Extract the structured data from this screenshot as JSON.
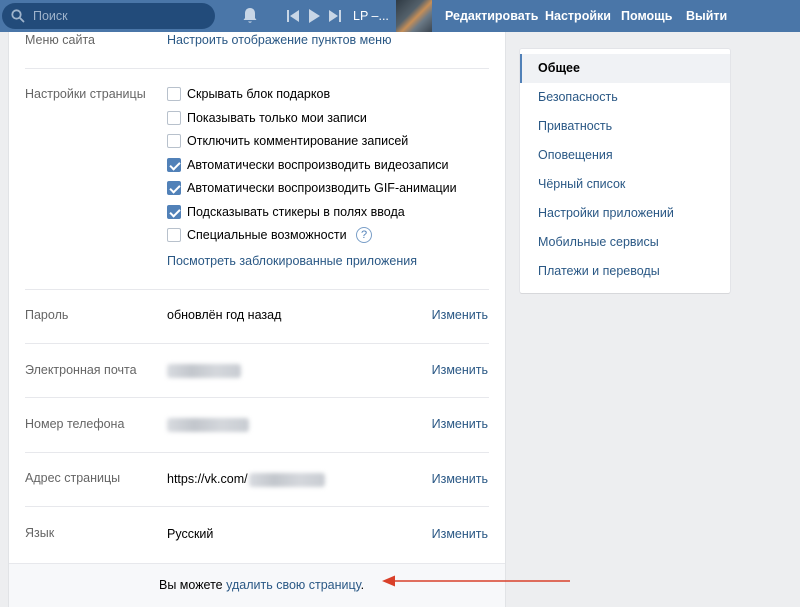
{
  "topbar": {
    "search_placeholder": "Поиск",
    "track_title": "LP –...",
    "nav": [
      "Редактировать",
      "Настройки",
      "Помощь",
      "Выйти"
    ]
  },
  "settings": {
    "site_menu_label": "Меню сайта",
    "site_menu_link": "Настроить отображение пунктов меню",
    "page_settings_label": "Настройки страницы",
    "checkboxes": [
      {
        "label": "Скрывать блок подарков",
        "checked": false
      },
      {
        "label": "Показывать только мои записи",
        "checked": false
      },
      {
        "label": "Отключить комментирование записей",
        "checked": false
      },
      {
        "label": "Автоматически воспроизводить видеозаписи",
        "checked": true
      },
      {
        "label": "Автоматически воспроизводить GIF-анимации",
        "checked": true
      },
      {
        "label": "Подсказывать стикеры в полях ввода",
        "checked": true
      },
      {
        "label": "Специальные возможности",
        "checked": false
      }
    ],
    "help_glyph": "?",
    "blocked_apps_link": "Посмотреть заблокированные приложения",
    "rows": [
      {
        "label": "Пароль",
        "value": "обновлён год назад",
        "action": "Изменить"
      },
      {
        "label": "Электронная почта",
        "value": "",
        "action": "Изменить"
      },
      {
        "label": "Номер телефона",
        "value": "",
        "action": "Изменить"
      },
      {
        "label": "Адрес страницы",
        "value": "https://vk.com/",
        "action": "Изменить"
      },
      {
        "label": "Язык",
        "value": "Русский",
        "action": "Изменить"
      }
    ],
    "footer_text": "Вы можете",
    "footer_link": "удалить свою страницу",
    "footer_end": "."
  },
  "right_menu": {
    "items": [
      {
        "label": "Общее",
        "active": true
      },
      {
        "label": "Безопасность"
      },
      {
        "label": "Приватность"
      },
      {
        "label": "Оповещения"
      },
      {
        "label": "Чёрный список"
      },
      {
        "label": "Настройки приложений"
      },
      {
        "label": "Мобильные сервисы"
      },
      {
        "label": "Платежи и переводы"
      }
    ]
  },
  "colors": {
    "topbar": "#4a76a8",
    "link": "#2a5885",
    "checkbox_on": "#5181b8",
    "arrow": "#d9402a"
  }
}
